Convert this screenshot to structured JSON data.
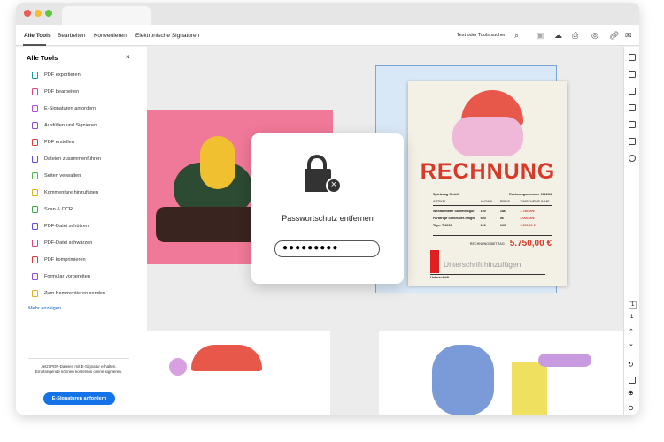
{
  "menu": {
    "tabs": [
      "Alle Tools",
      "Bearbeiten",
      "Konvertieren",
      "Elektronische Signaturen"
    ],
    "search": "Text oder Tools suchen"
  },
  "sidebar": {
    "title": "Alle Tools",
    "close": "×",
    "items": [
      {
        "label": "PDF exportieren",
        "color": "#1a9ca0"
      },
      {
        "label": "PDF bearbeiten",
        "color": "#e0457b"
      },
      {
        "label": "E-Signaturen anfordern",
        "color": "#b24fd4"
      },
      {
        "label": "Ausfüllen und Signieren",
        "color": "#8a4fd4"
      },
      {
        "label": "PDF erstellen",
        "color": "#e03a3a"
      },
      {
        "label": "Dateien zusammenführen",
        "color": "#5a4fe0"
      },
      {
        "label": "Seiten verwalten",
        "color": "#4cb84c"
      },
      {
        "label": "Kommentare hinzufügen",
        "color": "#e0b020"
      },
      {
        "label": "Scan & OCR",
        "color": "#3ca84c"
      },
      {
        "label": "PDF-Datei schützen",
        "color": "#5a4fe0"
      },
      {
        "label": "PDF-Datei schwärzen",
        "color": "#e0457b"
      },
      {
        "label": "PDF komprimieren",
        "color": "#e03a3a"
      },
      {
        "label": "Formular vorbereiten",
        "color": "#8a4fd4"
      },
      {
        "label": "Zum Kommentieren senden",
        "color": "#e0b020"
      }
    ],
    "more": "Mehr anzeigen",
    "promo": "Jetzt PDF-Dateien mit E-Signatur erhalten. Empfangende können kostenlos online signieren.",
    "promo_button": "E-Signaturen anfordern"
  },
  "modal": {
    "title": "Passwortschutz entfernen",
    "password": "●●●●●●●●●"
  },
  "invoice": {
    "title": "RECHNUNG",
    "company": "Spielzeug GmbH",
    "number": "Rechnungsnummer 001234",
    "headers": [
      "ARTIKEL",
      "ANZAHL",
      "PREIS",
      "ZWISCHENSUMME"
    ],
    "rows": [
      [
        "Weltraumaffe Sammelfigur",
        "100",
        "18€",
        "1.750,00€"
      ],
      [
        "Farbtropf Schleuder-Finger",
        "600",
        "5€",
        "3.000,00€"
      ],
      [
        "Tiger T-1000",
        "100",
        "10€",
        "1.000,00 €"
      ]
    ],
    "total_label": "RECHNUNGSBETRAG",
    "total": "5.750,00 €",
    "signature": "Unterschrift hinzufügen",
    "sign_label": "Unterschrift"
  },
  "pages": {
    "current": "1",
    "total": "1"
  }
}
